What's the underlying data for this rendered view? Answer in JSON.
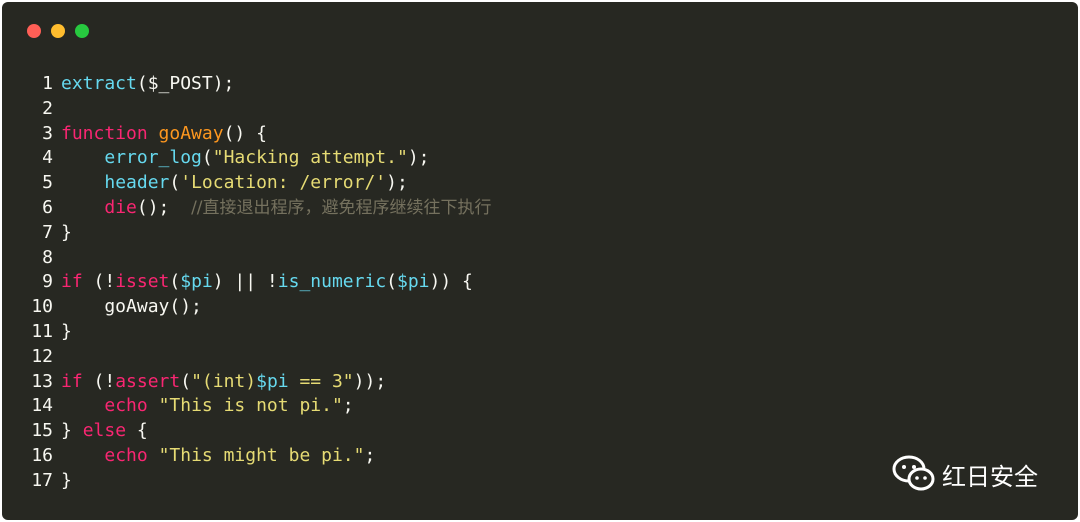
{
  "window": {
    "controls": {
      "close_color": "#ff5f56",
      "minimize_color": "#ffbd2e",
      "zoom_color": "#27c93f"
    }
  },
  "code": {
    "lines": [
      {
        "n": "1",
        "tokens": [
          [
            "fn",
            "extract"
          ],
          [
            "plain",
            "($_POST);"
          ]
        ]
      },
      {
        "n": "2",
        "tokens": []
      },
      {
        "n": "3",
        "tokens": [
          [
            "kw",
            "function"
          ],
          [
            "plain",
            " "
          ],
          [
            "dfn",
            "goAway"
          ],
          [
            "plain",
            "() {"
          ]
        ]
      },
      {
        "n": "4",
        "tokens": [
          [
            "plain",
            "    "
          ],
          [
            "fn",
            "error_log"
          ],
          [
            "plain",
            "("
          ],
          [
            "str",
            "\"Hacking attempt.\""
          ],
          [
            "plain",
            ");"
          ]
        ]
      },
      {
        "n": "5",
        "tokens": [
          [
            "plain",
            "    "
          ],
          [
            "fn",
            "header"
          ],
          [
            "plain",
            "("
          ],
          [
            "str",
            "'Location: /error/'"
          ],
          [
            "plain",
            ");"
          ]
        ]
      },
      {
        "n": "6",
        "tokens": [
          [
            "plain",
            "    "
          ],
          [
            "kw",
            "die"
          ],
          [
            "plain",
            "();  "
          ],
          [
            "cmt",
            "//直接退出程序，避免程序继续往下执行"
          ]
        ]
      },
      {
        "n": "7",
        "tokens": [
          [
            "plain",
            "}"
          ]
        ]
      },
      {
        "n": "8",
        "tokens": []
      },
      {
        "n": "9",
        "tokens": [
          [
            "kw",
            "if"
          ],
          [
            "plain",
            " (!"
          ],
          [
            "kw",
            "isset"
          ],
          [
            "plain",
            "("
          ],
          [
            "var",
            "$pi"
          ],
          [
            "plain",
            ") || !"
          ],
          [
            "fn",
            "is_numeric"
          ],
          [
            "plain",
            "("
          ],
          [
            "var",
            "$pi"
          ],
          [
            "plain",
            ")) {"
          ]
        ]
      },
      {
        "n": "10",
        "tokens": [
          [
            "plain",
            "    goAway();"
          ]
        ]
      },
      {
        "n": "11",
        "tokens": [
          [
            "plain",
            "}"
          ]
        ]
      },
      {
        "n": "12",
        "tokens": []
      },
      {
        "n": "13",
        "tokens": [
          [
            "kw",
            "if"
          ],
          [
            "plain",
            " (!"
          ],
          [
            "kw",
            "assert"
          ],
          [
            "plain",
            "("
          ],
          [
            "str",
            "\"(int)"
          ],
          [
            "var",
            "$pi"
          ],
          [
            "str",
            " == 3\""
          ],
          [
            "plain",
            "));"
          ]
        ]
      },
      {
        "n": "14",
        "tokens": [
          [
            "plain",
            "    "
          ],
          [
            "kw",
            "echo"
          ],
          [
            "plain",
            " "
          ],
          [
            "str",
            "\"This is not pi.\""
          ],
          [
            "plain",
            ";"
          ]
        ]
      },
      {
        "n": "15",
        "tokens": [
          [
            "plain",
            "} "
          ],
          [
            "kw",
            "else"
          ],
          [
            "plain",
            " {"
          ]
        ]
      },
      {
        "n": "16",
        "tokens": [
          [
            "plain",
            "    "
          ],
          [
            "kw",
            "echo"
          ],
          [
            "plain",
            " "
          ],
          [
            "str",
            "\"This might be pi.\""
          ],
          [
            "plain",
            ";"
          ]
        ]
      },
      {
        "n": "17",
        "tokens": [
          [
            "plain",
            "}"
          ]
        ]
      }
    ]
  },
  "watermark": {
    "icon": "wechat-icon",
    "text": "红日安全"
  }
}
